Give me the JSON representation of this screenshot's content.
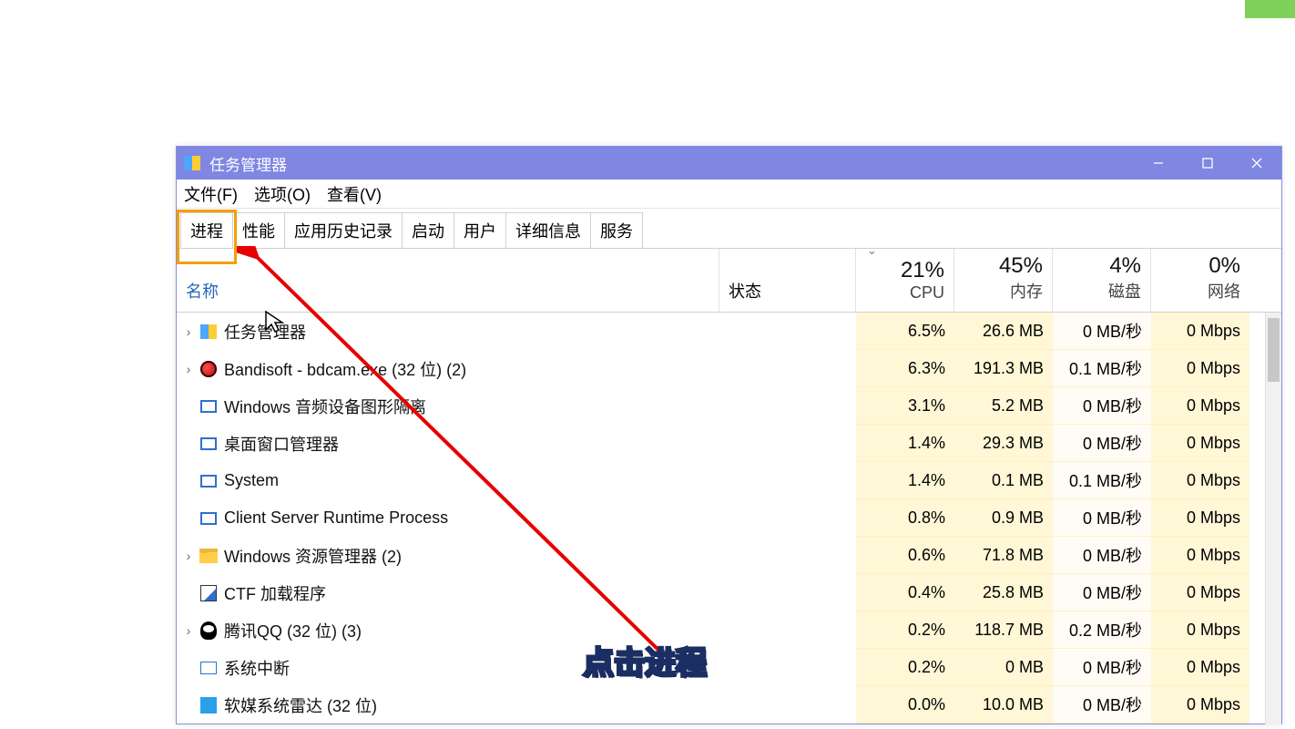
{
  "window_title": "任务管理器",
  "menubar": [
    "文件(F)",
    "选项(O)",
    "查看(V)"
  ],
  "tabs": [
    "进程",
    "性能",
    "应用历史记录",
    "启动",
    "用户",
    "详细信息",
    "服务"
  ],
  "columns": {
    "name": "名称",
    "status": "状态",
    "cpu": {
      "pct": "21%",
      "label": "CPU"
    },
    "mem": {
      "pct": "45%",
      "label": "内存"
    },
    "disk": {
      "pct": "4%",
      "label": "磁盘"
    },
    "net": {
      "pct": "0%",
      "label": "网络"
    }
  },
  "rows": [
    {
      "exp": true,
      "icon": "chart",
      "name": "任务管理器",
      "cpu": "6.5%",
      "mem": "26.6 MB",
      "disk": "0 MB/秒",
      "net": "0 Mbps"
    },
    {
      "exp": true,
      "icon": "reddot",
      "name": "Bandisoft - bdcam.exe (32 位) (2)",
      "cpu": "6.3%",
      "mem": "191.3 MB",
      "disk": "0.1 MB/秒",
      "net": "0 Mbps"
    },
    {
      "exp": false,
      "icon": "bluebox",
      "name": "Windows 音频设备图形隔离",
      "cpu": "3.1%",
      "mem": "5.2 MB",
      "disk": "0 MB/秒",
      "net": "0 Mbps"
    },
    {
      "exp": false,
      "icon": "bluebox",
      "name": "桌面窗口管理器",
      "cpu": "1.4%",
      "mem": "29.3 MB",
      "disk": "0 MB/秒",
      "net": "0 Mbps"
    },
    {
      "exp": false,
      "icon": "bluebox",
      "name": "System",
      "cpu": "1.4%",
      "mem": "0.1 MB",
      "disk": "0.1 MB/秒",
      "net": "0 Mbps"
    },
    {
      "exp": false,
      "icon": "bluebox",
      "name": "Client Server Runtime Process",
      "cpu": "0.8%",
      "mem": "0.9 MB",
      "disk": "0 MB/秒",
      "net": "0 Mbps"
    },
    {
      "exp": true,
      "icon": "folder",
      "name": "Windows 资源管理器 (2)",
      "cpu": "0.6%",
      "mem": "71.8 MB",
      "disk": "0 MB/秒",
      "net": "0 Mbps"
    },
    {
      "exp": false,
      "icon": "pencil",
      "name": "CTF 加载程序",
      "cpu": "0.4%",
      "mem": "25.8 MB",
      "disk": "0 MB/秒",
      "net": "0 Mbps"
    },
    {
      "exp": true,
      "icon": "qq",
      "name": "腾讯QQ (32 位) (3)",
      "cpu": "0.2%",
      "mem": "118.7 MB",
      "disk": "0.2 MB/秒",
      "net": "0 Mbps"
    },
    {
      "exp": false,
      "icon": "sys",
      "name": "系统中断",
      "cpu": "0.2%",
      "mem": "0 MB",
      "disk": "0 MB/秒",
      "net": "0 Mbps"
    },
    {
      "exp": false,
      "icon": "bluesq",
      "name": "软媒系统雷达 (32 位)",
      "cpu": "0.0%",
      "mem": "10.0 MB",
      "disk": "0 MB/秒",
      "net": "0 Mbps"
    }
  ],
  "annotation_caption": "点击进程"
}
